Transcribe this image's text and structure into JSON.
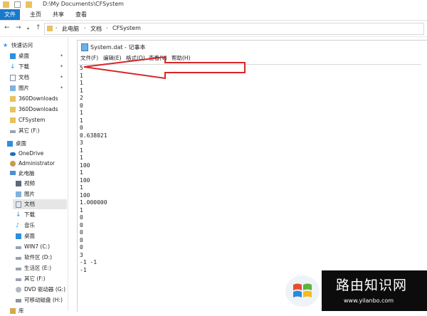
{
  "explorer": {
    "title_path": "D:\\My Documents\\CFSystem",
    "ribbon_tabs": [
      "文件",
      "主页",
      "共享",
      "查看"
    ],
    "breadcrumb": [
      "此电脑",
      "文档",
      "CFSystem"
    ],
    "sidebar": [
      {
        "label": "快速访问",
        "icon": "star-icon"
      },
      {
        "label": "桌面",
        "icon": "desktop-icon",
        "pinned": true
      },
      {
        "label": "下载",
        "icon": "download-icon",
        "pinned": true
      },
      {
        "label": "文档",
        "icon": "document-icon",
        "pinned": true
      },
      {
        "label": "图片",
        "icon": "picture-icon",
        "pinned": true
      },
      {
        "label": "360Downloads",
        "icon": "folder-icon"
      },
      {
        "label": "360Downloads",
        "icon": "folder-icon"
      },
      {
        "label": "CFSystem",
        "icon": "folder-icon"
      },
      {
        "label": "其它 (F:)",
        "icon": "drive-icon"
      },
      {
        "label": "桌面",
        "icon": "desktop-icon"
      },
      {
        "label": "OneDrive",
        "icon": "cloud-icon"
      },
      {
        "label": "Administrator",
        "icon": "user-icon"
      },
      {
        "label": "此电脑",
        "icon": "computer-icon"
      },
      {
        "label": "视频",
        "icon": "video-icon"
      },
      {
        "label": "图片",
        "icon": "picture-icon"
      },
      {
        "label": "文档",
        "icon": "document-icon",
        "selected": true
      },
      {
        "label": "下载",
        "icon": "download-icon"
      },
      {
        "label": "音乐",
        "icon": "music-icon"
      },
      {
        "label": "桌面",
        "icon": "desktop-icon"
      },
      {
        "label": "WIN7 (C:)",
        "icon": "drive-icon"
      },
      {
        "label": "软件区 (D:)",
        "icon": "drive-icon"
      },
      {
        "label": "生活区 (E:)",
        "icon": "drive-icon"
      },
      {
        "label": "其它 (F:)",
        "icon": "drive-icon"
      },
      {
        "label": "DVD 驱动器 (G:)",
        "icon": "dvd-icon"
      },
      {
        "label": "可移动磁盘 (H:)",
        "icon": "usb-icon"
      },
      {
        "label": "库",
        "icon": "library-icon"
      }
    ]
  },
  "notepad": {
    "title": "System.dat - 记事本",
    "menu": [
      "文件(F)",
      "编辑(E)",
      "格式(O)",
      "查看(V)",
      "帮助(H)"
    ],
    "content": "5\n1\n1\n1\n2\n0\n1\n1\n0\n0.638021\n3\n1\n1\n100\n1\n100\n1\n100\n1.000000\n1\n0\n0\n0\n0\n0\n3\n-1 -1\n-1"
  },
  "annotation": {
    "color": "#d9262a"
  },
  "watermark": {
    "title": "路由知识网",
    "url": "www.yilanbo.com"
  }
}
